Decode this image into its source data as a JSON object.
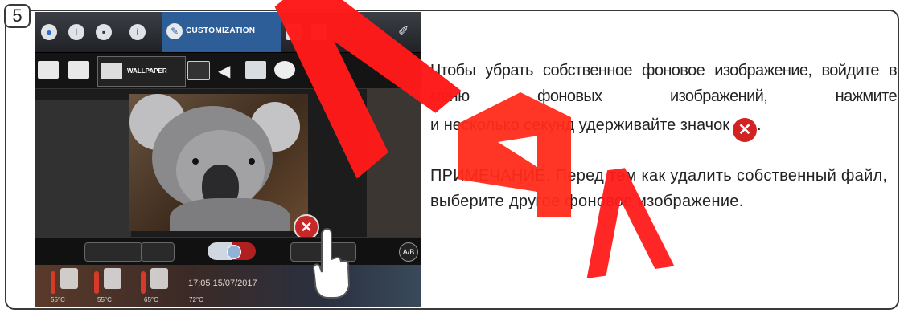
{
  "step": {
    "number": "5"
  },
  "device": {
    "top_tab_label": "CUSTOMIZATION",
    "sub_tab_label": "WALLPAPER",
    "footer": {
      "datetime": "17:05 15/07/2017",
      "temperatures": [
        "55°C",
        "55°C",
        "65°C",
        "72°C"
      ],
      "arrow": "◂)"
    },
    "delete_glyph": "✕",
    "ab_label": "A/B"
  },
  "instructions": {
    "para1_main": "Чтобы убрать собственное фоновое изображение, войдите в меню фоновых изображений, нажмите",
    "para1_tail": "и несколько секунд удерживайте значок",
    "para1_end": ".",
    "icon_glyph": "✕",
    "note": "ПРИМЕЧАНИЕ. Перед тем как удалить собственный файл, выберите другое фоновое изображение."
  },
  "colors": {
    "accent_tab": "#2e5e97",
    "delete_red": "#d32222",
    "watermark": "#ff1a1a"
  },
  "icons": [
    "drop-icon",
    "clock-icon",
    "flag-icon",
    "info-icon",
    "pen-icon",
    "tray-icon",
    "chef-icon",
    "wrench-icon",
    "book-icon",
    "wallpaper-icon",
    "speaker-icon",
    "weather-icon",
    "palette-icon"
  ]
}
